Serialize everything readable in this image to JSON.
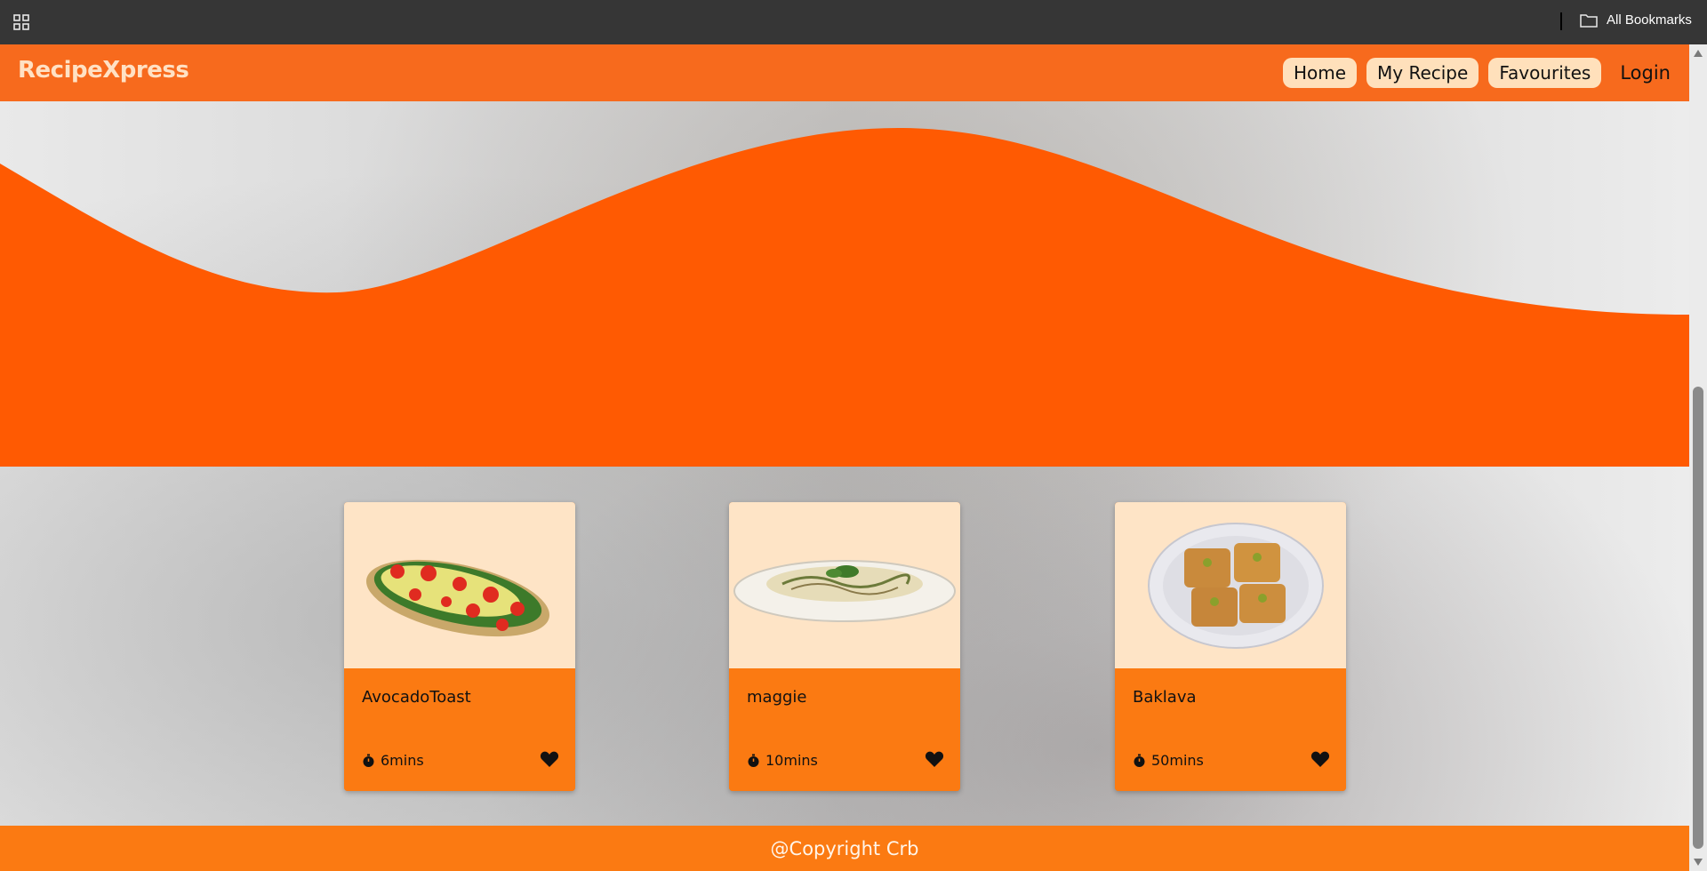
{
  "browser": {
    "bookmarks_label": "All Bookmarks"
  },
  "navbar": {
    "brand": "RecipeXpress",
    "links": [
      "Home",
      "My Recipe",
      "Favourites"
    ],
    "login": "Login"
  },
  "recipes": [
    {
      "title": "AvocadoToast",
      "time": "6mins",
      "image_icon": "avocado-toast-image"
    },
    {
      "title": "maggie",
      "time": "10mins",
      "image_icon": "maggie-noodles-image"
    },
    {
      "title": "Baklava",
      "time": "50mins",
      "image_icon": "baklava-image"
    }
  ],
  "footer": {
    "text": "@Copyright Crb"
  },
  "colors": {
    "navbar": "#f76a1d",
    "wave": "#ff5a02",
    "card_image_bg": "#fee4c6",
    "card_body": "#fb7a12",
    "pill": "#ffe0bb",
    "brand_text": "#ffe1c4"
  }
}
